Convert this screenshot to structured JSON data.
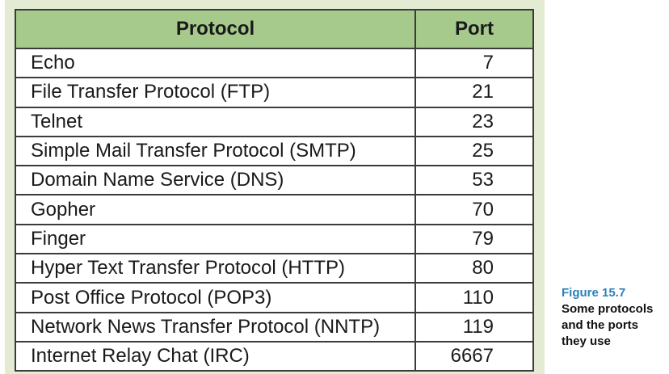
{
  "table": {
    "headers": {
      "protocol": "Protocol",
      "port": "Port"
    },
    "rows": [
      {
        "protocol": "Echo",
        "port": "7"
      },
      {
        "protocol": "File Transfer Protocol (FTP)",
        "port": "21"
      },
      {
        "protocol": "Telnet",
        "port": "23"
      },
      {
        "protocol": "Simple Mail Transfer Protocol (SMTP)",
        "port": "25"
      },
      {
        "protocol": "Domain Name Service (DNS)",
        "port": "53"
      },
      {
        "protocol": "Gopher",
        "port": "70"
      },
      {
        "protocol": "Finger",
        "port": "79"
      },
      {
        "protocol": "Hyper Text Transfer Protocol (HTTP)",
        "port": "80"
      },
      {
        "protocol": "Post Office Protocol (POP3)",
        "port": "110"
      },
      {
        "protocol": "Network News Transfer Protocol (NNTP)",
        "port": "119"
      },
      {
        "protocol": "Internet Relay Chat (IRC)",
        "port": "6667"
      }
    ]
  },
  "caption": {
    "figure_number": "Figure 15.7",
    "text": "Some protocols\nand the ports\nthey use"
  },
  "colors": {
    "panel_background": "#e3ecd3",
    "header_background": "#a6c98c",
    "border": "#3b3b3b",
    "figure_number": "#2a80b9"
  }
}
